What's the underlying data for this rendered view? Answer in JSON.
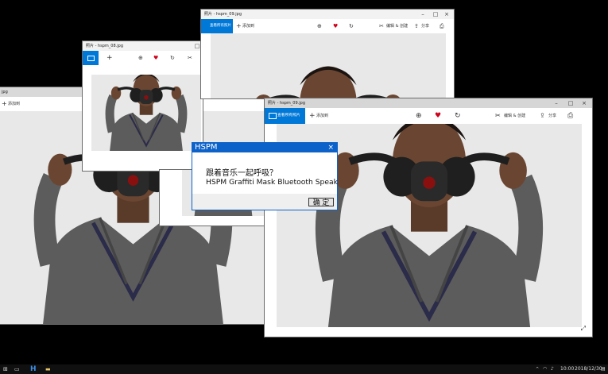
{
  "colors": {
    "accent": "#0078d7",
    "dialog_blue": "#0d62c9",
    "favorite": "#d0021b"
  },
  "windows": {
    "left": {
      "title": "jpg",
      "add_label": "添加到"
    },
    "small": {
      "title": "照片 - hspm_08.jpg",
      "add_label": "+"
    },
    "top": {
      "title": "照片 - hspm_09.jpg",
      "view_all_label": "查看所有照片",
      "add_label": "添加到",
      "edit_label": "编辑 & 创建",
      "share_label": "分享"
    },
    "front": {
      "title": "照片 - hspm_09.jpg",
      "view_all_label": "查看所有照片",
      "add_label": "添加到",
      "edit_label": "编辑 & 创建",
      "share_label": "分享"
    }
  },
  "dialog": {
    "title": "HSPM",
    "message_line1": "跟着音乐一起呼吸？",
    "message_line2": "HSPM Graffiti Mask Bluetooth Speaker",
    "ok_label": "确 定"
  },
  "taskbar": {
    "time": "10:00",
    "date": "2018/12/30",
    "app_label": "H"
  },
  "icons": {
    "zoom": "zoom-icon",
    "favorite": "heart-icon",
    "rotate": "rotate-icon",
    "edit": "edit-icon",
    "share": "share-icon",
    "print": "print-icon",
    "fullscreen": "expand-icon"
  }
}
